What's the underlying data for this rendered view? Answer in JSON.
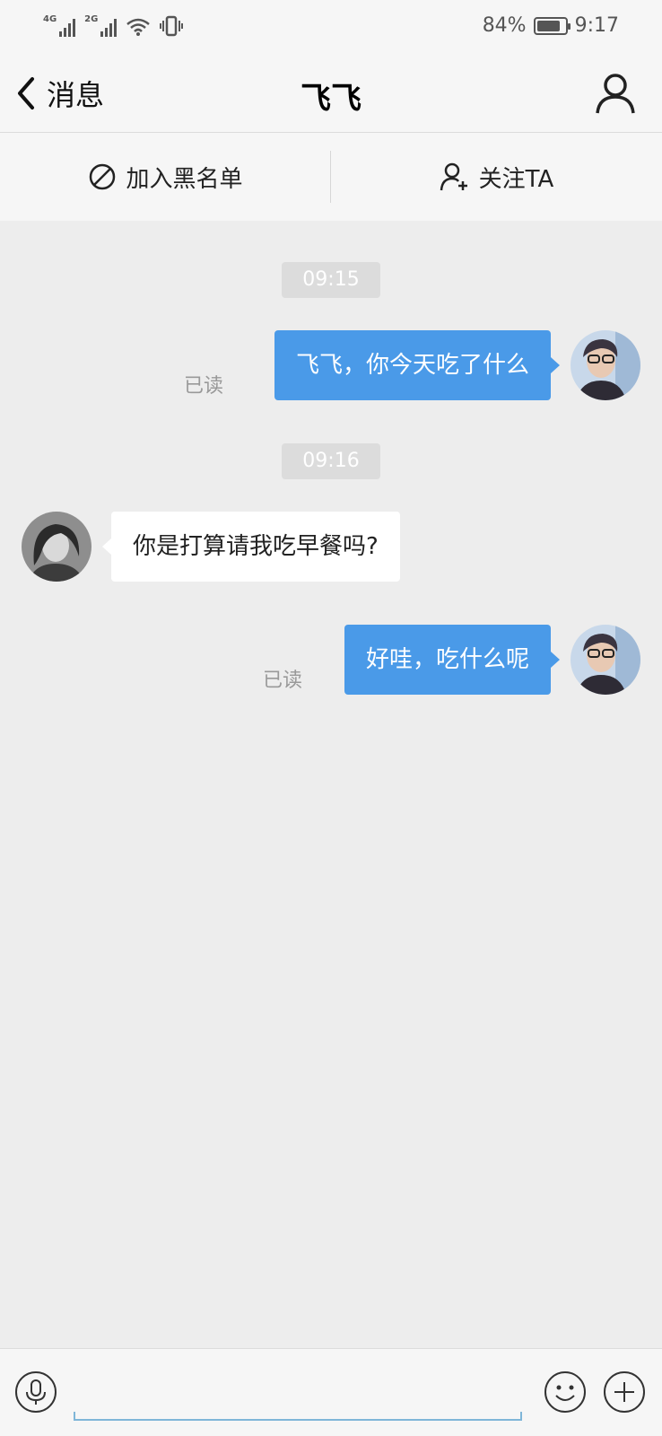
{
  "status_bar": {
    "net1": "4G",
    "net2": "2G",
    "battery_text": "84%",
    "battery_level": 0.84,
    "time": "9:17",
    "icons": [
      "signal-icon",
      "wifi-icon",
      "vibrate-icon",
      "battery-icon"
    ]
  },
  "header": {
    "back_label": "消息",
    "title": "飞飞"
  },
  "actions": {
    "block_label": "加入黑名单",
    "follow_label": "关注TA"
  },
  "messages": [
    {
      "type": "time",
      "text": "09:15"
    },
    {
      "type": "out",
      "text": "飞飞，你今天吃了什么",
      "status": "已读"
    },
    {
      "type": "time",
      "text": "09:16"
    },
    {
      "type": "in",
      "text": "你是打算请我吃早餐吗?"
    },
    {
      "type": "out",
      "text": "好哇，吃什么呢",
      "status": "已读"
    }
  ],
  "input": {
    "placeholder": "",
    "value": ""
  },
  "colors": {
    "accent": "#4a9ae8",
    "background": "#ededed",
    "bar": "#f6f6f6"
  }
}
